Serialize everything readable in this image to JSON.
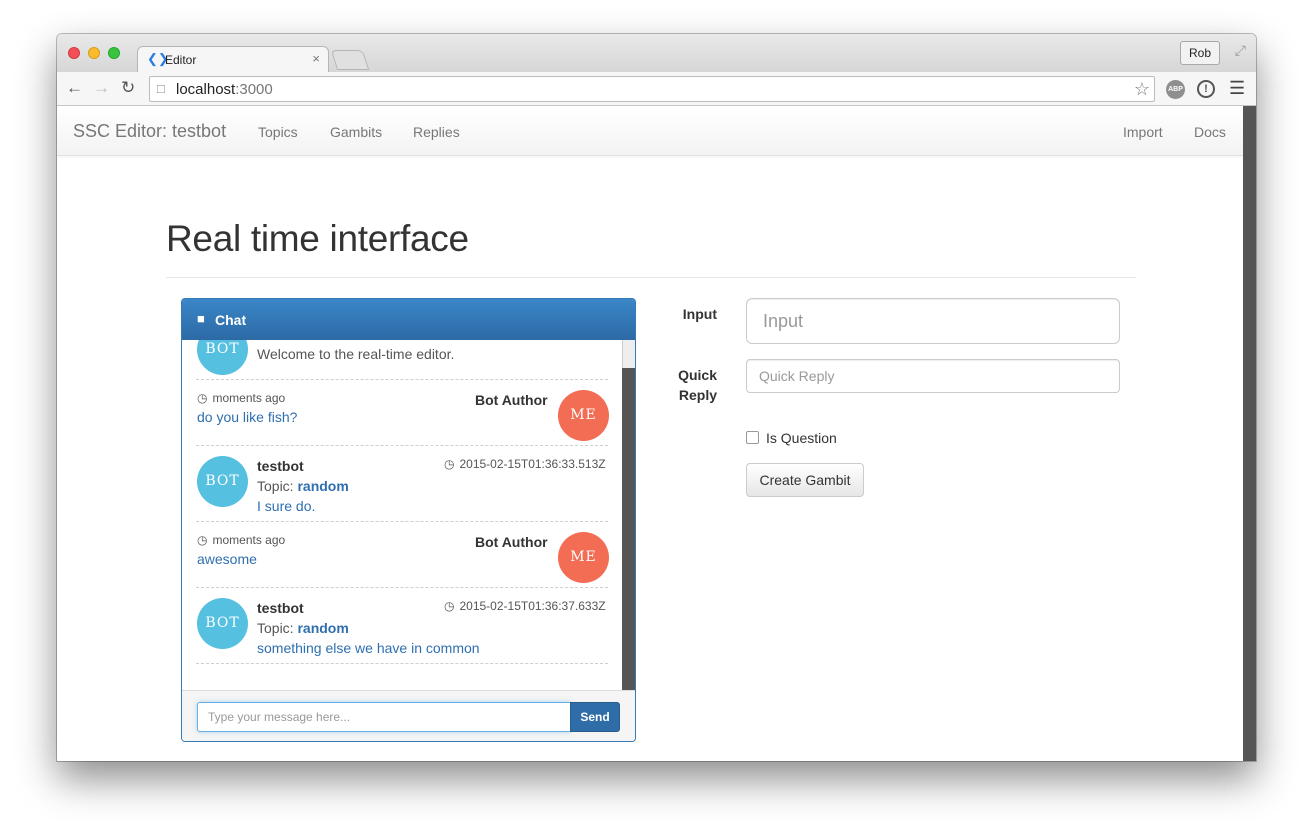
{
  "browser": {
    "tab_title": "Editor",
    "tab_icon": "editor-icon",
    "tab_close": "×",
    "profile_name": "Rob",
    "url_host": "localhost",
    "url_port": ":3000",
    "ext_abp_label": "ABP"
  },
  "navbar": {
    "brand": "SSC Editor: testbot",
    "links": [
      "Topics",
      "Gambits",
      "Replies"
    ],
    "right_links": [
      "Import",
      "Docs"
    ]
  },
  "page": {
    "title": "Real time interface"
  },
  "chat": {
    "title": "Chat",
    "messages": [
      {
        "type": "bot",
        "avatar": "BOT",
        "text": "Welcome to the real-time editor."
      },
      {
        "type": "me",
        "avatar": "ME",
        "time": "moments ago",
        "author": "Bot Author",
        "text": "do you like fish?"
      },
      {
        "type": "bot",
        "avatar": "BOT",
        "author": "testbot",
        "time": "2015-02-15T01:36:33.513Z",
        "topic_label": "Topic:",
        "topic": "random",
        "text": "I sure do."
      },
      {
        "type": "me",
        "avatar": "ME",
        "time": "moments ago",
        "author": "Bot Author",
        "text": "awesome"
      },
      {
        "type": "bot",
        "avatar": "BOT",
        "author": "testbot",
        "time": "2015-02-15T01:36:37.633Z",
        "topic_label": "Topic:",
        "topic": "random",
        "text": "something else we have in common"
      }
    ],
    "input_placeholder": "Type your message here...",
    "send_label": "Send"
  },
  "form": {
    "input_label": "Input",
    "input_placeholder": "Input",
    "quick_reply_label_1": "Quick",
    "quick_reply_label_2": "Reply",
    "quick_reply_placeholder": "Quick Reply",
    "is_question_label": "Is Question",
    "is_question_checked": false,
    "create_button": "Create Gambit"
  },
  "colors": {
    "primary": "#337ab7",
    "bot_avatar": "#55c0e0",
    "me_avatar": "#f36d55",
    "link": "#2f6faf"
  }
}
